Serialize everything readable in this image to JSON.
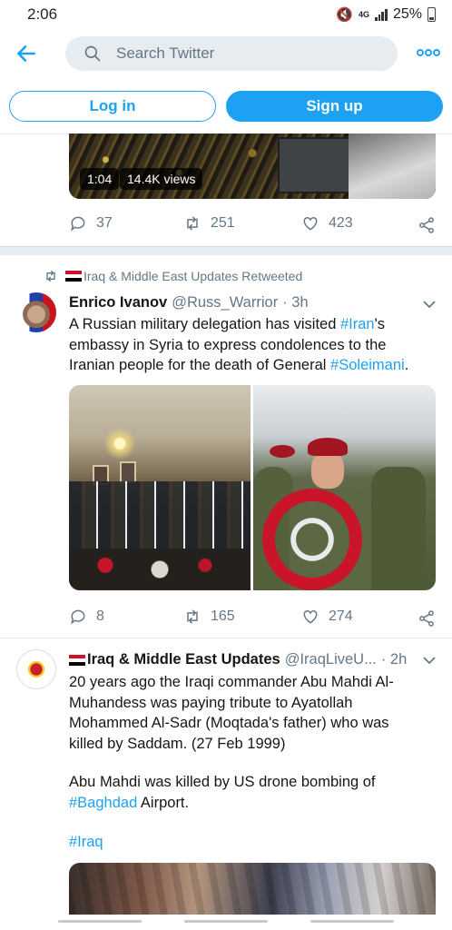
{
  "status_bar": {
    "time": "2:06",
    "network": "4G",
    "battery": "25%"
  },
  "header": {
    "search_placeholder": "Search Twitter",
    "back_icon": "arrow-left-icon",
    "more_icon": "more-horizontal-icon"
  },
  "auth": {
    "login_label": "Log in",
    "signup_label": "Sign up"
  },
  "colors": {
    "accent": "#1da1f2",
    "muted_text": "#657786",
    "separator": "#e6ecf0"
  },
  "feed": {
    "previous_tweet": {
      "video_duration": "1:04",
      "video_views": "14.4K views",
      "replies": "37",
      "retweets": "251",
      "likes": "423"
    },
    "tweet1": {
      "retweeted_by": "Iraq & Middle East Updates Retweeted",
      "name": "Enrico Ivanov",
      "handle": "@Russ_Warrior",
      "time": "· 3h",
      "text_1": "A Russian military delegation has visited ",
      "hashtag_1": "#Iran",
      "text_2": "'s embassy in Syria to express condolences to the Iranian people for the death of General ",
      "hashtag_2": "#Soleimani",
      "text_3": ".",
      "replies": "8",
      "retweets": "165",
      "likes": "274"
    },
    "tweet2": {
      "name": "Iraq & Middle East Updates",
      "handle": "@IraqLiveU...",
      "time": "· 2h",
      "paragraph_1": "20 years ago the Iraqi commander Abu Mahdi Al-Muhandess was paying tribute to Ayatollah Mohammed Al-Sadr (Moqtada's father) who was killed by Saddam. (27 Feb 1999)",
      "paragraph_2_text": "Abu Mahdi was killed by US drone bombing of ",
      "paragraph_2_hashtag": "#Baghdad",
      "paragraph_2_end": " Airport.",
      "hashtag_line": "#Iraq"
    }
  }
}
